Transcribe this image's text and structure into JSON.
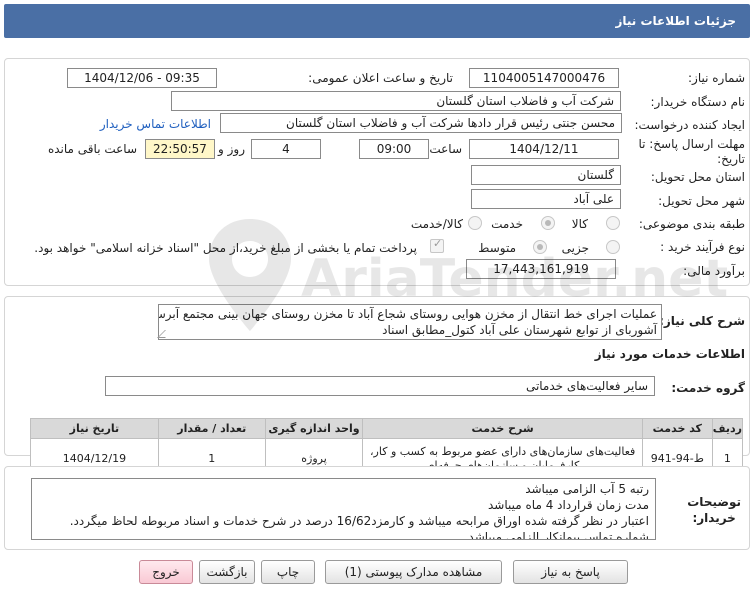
{
  "header": {
    "title": "جزئیات اطلاعات نیاز"
  },
  "fields": {
    "need_number_label": "شماره نیاز:",
    "need_number": "1104005147000476",
    "announce_label": "تاریخ و ساعت اعلان عمومی:",
    "announce_value": "1404/12/06 - 09:35",
    "buyer_org_label": "نام دستگاه خریدار:",
    "buyer_org": "شرکت آب و فاضلاب استان گلستان",
    "creator_label": "ایجاد کننده درخواست:",
    "creator": "محسن جنتی رئیس قرار دادها شرکت آب و فاضلاب استان گلستان",
    "contact_link": "اطلاعات تماس خریدار",
    "deadline_label": "مهلت ارسال پاسخ: تا تاریخ:",
    "deadline_date": "1404/12/11",
    "time_label": "ساعت",
    "deadline_time": "09:00",
    "day_label": "روز و",
    "days_value": "4",
    "remaining_time": "22:50:57",
    "remaining_label": "ساعت باقی مانده",
    "province_label": "استان محل تحویل:",
    "province": "گلستان",
    "city_label": "شهر محل تحویل:",
    "city": "علی آباد",
    "category_label": "طبقه بندی موضوعی:",
    "category_options": [
      "کالا",
      "خدمت",
      "کالا/خدمت"
    ],
    "category_selected": 1,
    "process_label": "نوع فرآیند خرید :",
    "process_options": [
      "جزیی",
      "متوسط"
    ],
    "process_selected": 1,
    "payment_note": "پرداخت تمام یا بخشی از مبلغ خرید،از محل \"اسناد خزانه اسلامی\" خواهد بود.",
    "estimate_label": "برآورد مالی:",
    "estimate": "17,443,161,919"
  },
  "summary": {
    "label": "شرح کلی نیاز:",
    "text_line1": "عملیات اجرای خط انتقال از مخزن هوایی روستای شجاع آباد تا مخزن روستای جهان بینی مجتمع آبرسانی",
    "text_line2": "آشوربای از توابع شهرستان علی آباد کتول_مطابق اسناد"
  },
  "services": {
    "section_title": "اطلاعات خدمات مورد نیاز",
    "group_label": "گروه خدمت:",
    "group_value": "سایر فعالیت‌های خدماتی",
    "columns": [
      "ردیف",
      "کد خدمت",
      "شرح خدمت",
      "واحد اندازه گیری",
      "تعداد / مقدار",
      "تاریخ نیاز"
    ],
    "rows": [
      {
        "row": "1",
        "code": "ط-94-941",
        "desc_line1": "فعالیت‌های سازمان‌های دارای عضو مربوط به کسب و کار،",
        "desc_line2": "کارفرمایان و سازمان‌های حرفه‌ای",
        "unit": "پروژه",
        "qty": "1",
        "date": "1404/12/19"
      }
    ]
  },
  "buyer_notes": {
    "label_line1": "توضیحات",
    "label_line2": "خریدار:",
    "lines": [
      "رتبه 5 آب الزامی میباشد",
      "مدت زمان قرارداد 4 ماه میباشد",
      "اعتبار در نظر گرفته شده اوراق مرابحه میباشد و کارمزد16/62 درصد در شرح خدمات و اسناد مربوطه لحاظ میگردد.",
      "شماره تماس پیمانکار الزامی میباشد"
    ]
  },
  "buttons": {
    "reply": "پاسخ به نیاز",
    "attachments": "مشاهده مدارک پیوستی (1)",
    "print": "چاپ",
    "back": "بازگشت",
    "exit": "خروج"
  },
  "watermark": {
    "text": "AriaTender.net"
  }
}
